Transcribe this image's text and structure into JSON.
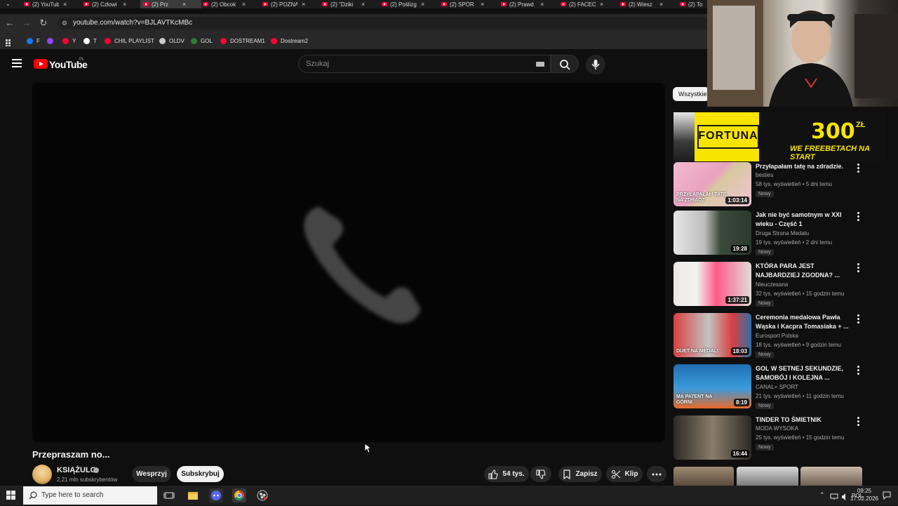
{
  "browser": {
    "tabs": [
      {
        "title": "(2) YouTub"
      },
      {
        "title": "(2) Człowi"
      },
      {
        "title": "(2) Prz"
      },
      {
        "title": "(2) Obcok"
      },
      {
        "title": "(2) POZNA"
      },
      {
        "title": "(2) \"Dziki"
      },
      {
        "title": "(2) Poślizg"
      },
      {
        "title": "(2) SPÓR"
      },
      {
        "title": "(2) Prawd"
      },
      {
        "title": "(2) FACEC"
      },
      {
        "title": "(2) Wiesz"
      },
      {
        "title": "(2) To"
      }
    ],
    "address": "youtube.com/watch?v=BJLAVTKcMBc",
    "bookmarks": [
      {
        "label": "F",
        "color": "#1877f2"
      },
      {
        "label": "",
        "color": "#9146ff"
      },
      {
        "label": "Y",
        "color": "#ff0033"
      },
      {
        "label": "T",
        "color": "#ffffff"
      },
      {
        "label": "CHIL PLAYLIST",
        "color": "#ff0033"
      },
      {
        "label": "OLDV",
        "color": "#cccccc"
      },
      {
        "label": "GOL",
        "color": "#2e7d32"
      },
      {
        "label": "DOSTREAM1",
        "color": "#ff0033"
      },
      {
        "label": "Dostream2",
        "color": "#ff0033"
      }
    ]
  },
  "youtube": {
    "logo_text": "YouTube",
    "region": "PL",
    "search_placeholder": "Szukaj"
  },
  "video": {
    "title": "Przepraszam no...",
    "channel": "KSIĄŻULO",
    "subscribers": "2,21 mln subskrybentów",
    "support_label": "Wesprzyj",
    "subscribe_label": "Subskrybuj",
    "likes": "54 tys.",
    "save_label": "Zapisz",
    "clip_label": "Klip"
  },
  "sidebar": {
    "chip_label": "Wszystkie",
    "ad": {
      "brand": "FORTUNA",
      "amount": "300",
      "currency": "ZŁ",
      "tagline": "WE FREEBETACH NA START"
    },
    "recommendations": [
      {
        "title": "Przyłapałam tatę na zdradzie.",
        "channel": "besties",
        "meta": "58 tys. wyświetleń • 5 dni temu",
        "badge": "Nowy",
        "duration": "1:03:14",
        "thumb_caption": "PRZYŁAPAŁAM TATĘ NA ZDRADZ"
      },
      {
        "title": "Jak nie być samotnym w XXI wieku - Część 1",
        "channel": "Druga Strona Medalu",
        "meta": "19 tys. wyświetleń • 2 dni temu",
        "badge": "Nowy",
        "duration": "19:28"
      },
      {
        "title": "KTÓRA PARA JEST NAJBARDZIEJ ZGODNA? ...",
        "channel": "Nieuczesana",
        "meta": "32 tys. wyświetleń • 15 godzin temu",
        "badge": "Nowy",
        "duration": "1:37:21"
      },
      {
        "title": "Ceremonia medalowa Pawła Wąska i Kacpra Tomasiaka + ...",
        "channel": "Eurosport Polska",
        "meta": "18 tys. wyświetleń • 9 godzin temu",
        "badge": "Nowy",
        "duration": "18:03",
        "thumb_caption": "DUET NA MEDAL!"
      },
      {
        "title": "GOL W SETNEJ SEKUNDZIE, SAMOBÓJ I KOLEJNA ...",
        "channel": "CANAL+ SPORT",
        "meta": "21 tys. wyświetleń • 11 godzin temu",
        "badge": "Nowy",
        "duration": "8:19",
        "thumb_caption": "MA PATENT NA GÓRNI"
      },
      {
        "title": "TINDER TO ŚMIETNIK",
        "channel": "MODA WYSOKA",
        "meta": "25 tys. wyświetleń • 15 godzin temu",
        "badge": "Nowy",
        "duration": "16:44"
      }
    ]
  },
  "taskbar": {
    "search_placeholder": "Type here to search",
    "language": "POL",
    "time": "09:25",
    "date": "17.02.2026"
  }
}
